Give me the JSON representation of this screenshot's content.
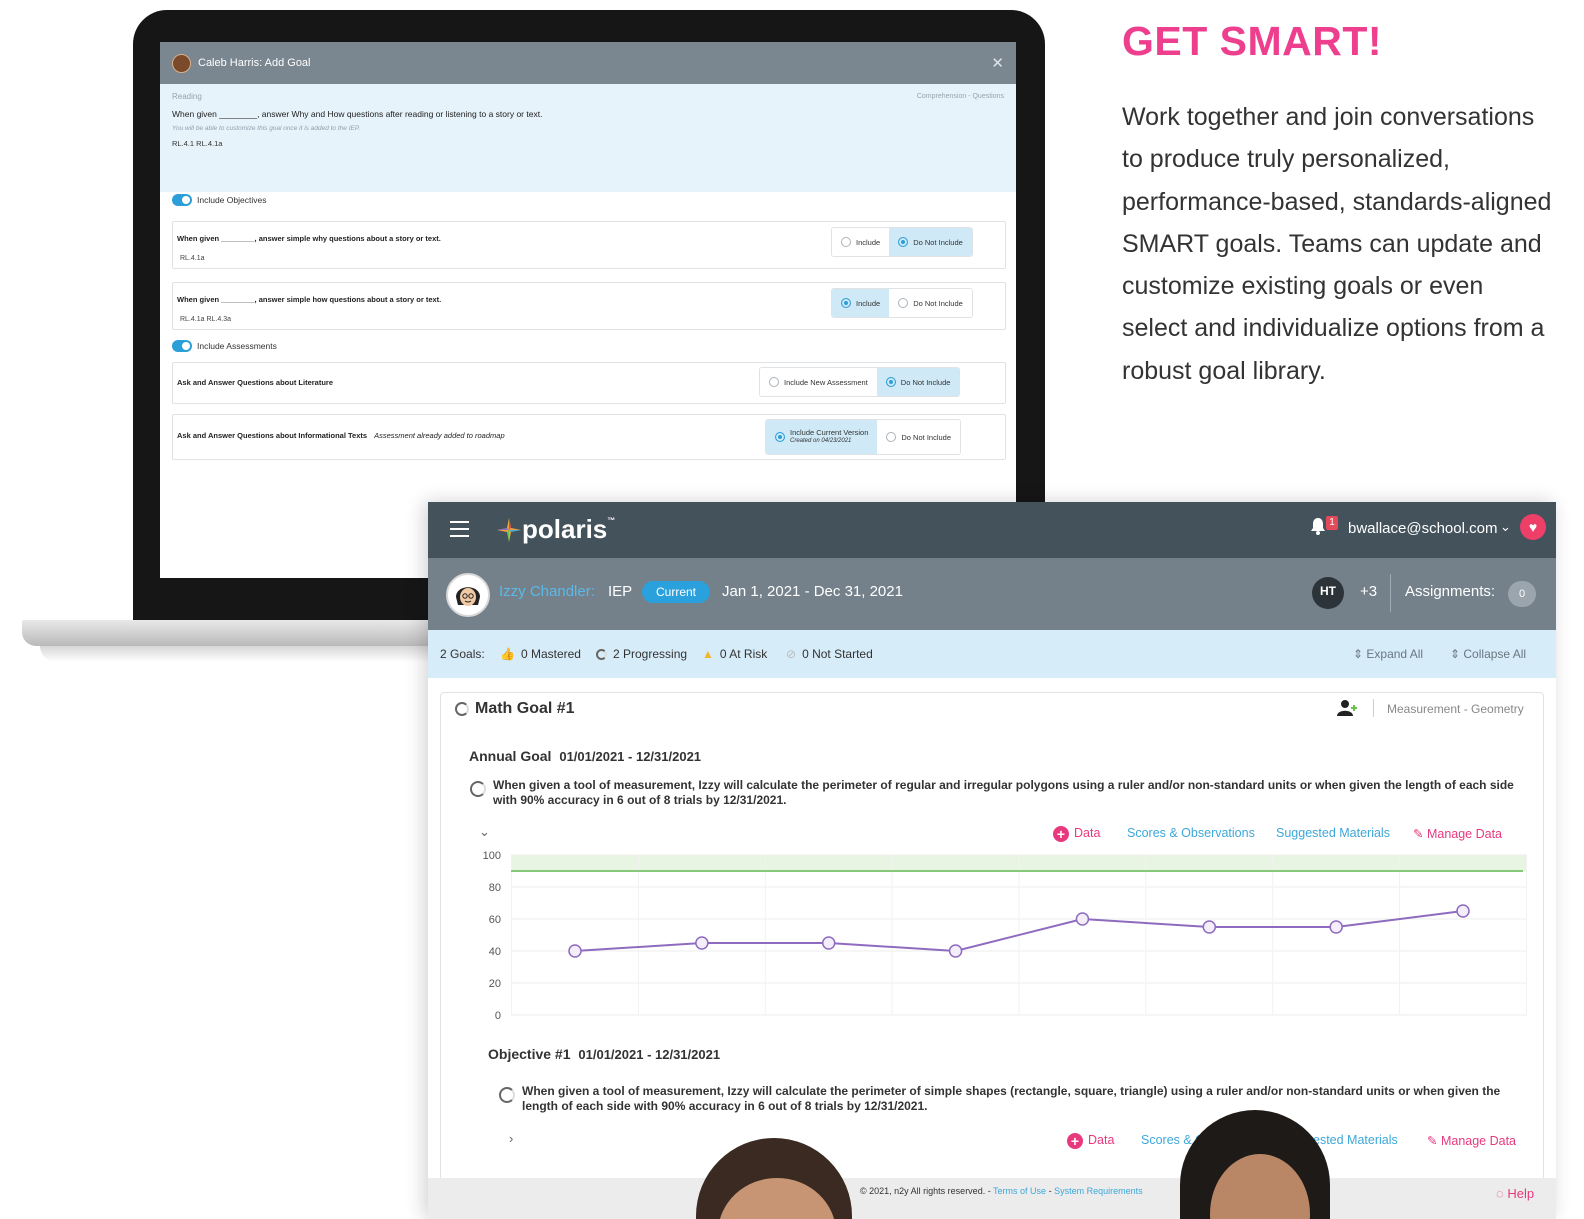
{
  "marketing": {
    "title": "GET SMART!",
    "body": "Work together and join conversations to produce truly personalized, performance-based, standards-aligned SMART goals. Teams can update and customize existing goals or even select and individualize options from a robust goal library."
  },
  "modal": {
    "title": "Caleb Harris: Add Goal",
    "subject": "Reading",
    "category": "Comprehension - Questions",
    "goal_text": "When given ________, answer Why and How questions after reading or listening to a story or text.",
    "note": "You will be able to customize this goal once it is added to the IEP.",
    "standards": "RL.4.1   RL.4.1a",
    "objectives_toggle": "Include Objectives",
    "assessments_toggle": "Include Assessments",
    "objectives": [
      {
        "text": "When given ________, answer simple why questions about a story or text.",
        "standards": "RL.4.1a",
        "opt_a": "Include",
        "opt_b": "Do Not Include",
        "selected": "Do Not Include"
      },
      {
        "text": "When given ________, answer simple how questions about a story or text.",
        "standards": "RL.4.1a   RL.4.3a",
        "opt_a": "Include",
        "opt_b": "Do Not Include",
        "selected": "Include"
      }
    ],
    "assessments": [
      {
        "text": "Ask and Answer Questions about Literature",
        "opt_a": "Include New Assessment",
        "opt_b": "Do Not Include",
        "selected": "Do Not Include"
      },
      {
        "text": "Ask and Answer Questions about Informational Texts",
        "note": "Assessment already added to roadmap",
        "opt_a": "Include Current Version",
        "opt_a_sub": "Created on 04/23/2021",
        "opt_b": "Do Not Include",
        "selected": "Include Current Version"
      }
    ]
  },
  "app": {
    "logo": "polaris",
    "notification_count": "1",
    "user_email": "bwallace@school.com",
    "student": {
      "name": "Izzy Chandler:",
      "plan": "IEP",
      "status": "Current",
      "dates": "Jan 1, 2021 - Dec 31, 2021",
      "team_initials": "HT",
      "team_more": "+3",
      "assignments_label": "Assignments:",
      "assignments_count": "0"
    },
    "summary": {
      "goals": "2 Goals:",
      "mastered": "0 Mastered",
      "progressing": "2 Progressing",
      "at_risk": "0 At Risk",
      "not_started": "0 Not Started",
      "expand": "Expand All",
      "collapse": "Collapse All"
    },
    "goal": {
      "title": "Math Goal #1",
      "category": "Measurement - Geometry",
      "annual_label": "Annual Goal",
      "annual_dates": "01/01/2021  -  12/31/2021",
      "text": "When given a tool of measurement, Izzy will calculate the perimeter of regular and irregular polygons using a ruler and/or non-standard units or when given the length of each side with 90% accuracy in 6 out of 8 trials by 12/31/2021.",
      "links": {
        "data": "Data",
        "scores": "Scores & Observations",
        "materials": "Suggested Materials",
        "manage": "Manage Data"
      },
      "objective_label": "Objective #1",
      "objective_dates": "01/01/2021  -  12/31/2021",
      "objective_text": "When given a tool of measurement, Izzy will calculate the perimeter of simple shapes (rectangle, square, triangle) using a ruler and/or non-standard units or when given the length of each side with 90% accuracy in 6 out of 8 trials by 12/31/2021.",
      "objective_links": {
        "data": "Data",
        "scores": "Scores & O",
        "materials": "ested Materials",
        "manage": "Manage Data"
      }
    },
    "footer": {
      "copyright": "© 2021, n2y All rights reserved. -",
      "terms": "Terms of Use",
      "sep": "-",
      "requirements": "System Requirements",
      "help": "Help"
    }
  },
  "chart_data": {
    "type": "line",
    "y_ticks": [
      "100",
      "80",
      "60",
      "40",
      "20",
      "0"
    ],
    "ylim": [
      0,
      100
    ],
    "target": 90,
    "values": [
      40,
      45,
      45,
      40,
      60,
      55,
      55,
      65
    ],
    "colors": {
      "line": "#8e6bbf",
      "target": "#86c77a",
      "target_band": "#e8f5e2"
    }
  },
  "colors": {
    "brand_pink": "#ee3f8f",
    "topbar": "#44525c",
    "student_bar": "#74818a",
    "summary_bar": "#d6ecf8",
    "link_blue": "#3da8d9"
  }
}
